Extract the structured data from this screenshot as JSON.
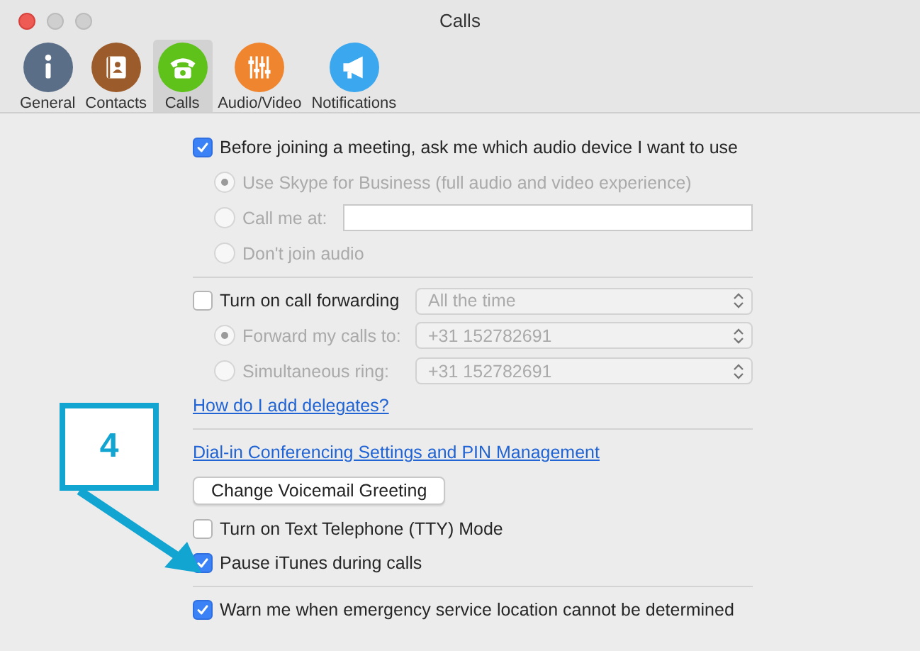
{
  "window": {
    "title": "Calls"
  },
  "toolbar": [
    {
      "label": "General",
      "kind": "info",
      "color": "#5b6e88",
      "selected": false
    },
    {
      "label": "Contacts",
      "kind": "contacts",
      "color": "#9c5b2a",
      "selected": false
    },
    {
      "label": "Calls",
      "kind": "phone",
      "color": "#5fc21a",
      "selected": true
    },
    {
      "label": "Audio/Video",
      "kind": "sliders",
      "color": "#f08530",
      "selected": false
    },
    {
      "label": "Notifications",
      "kind": "megaphone",
      "color": "#3aa7ee",
      "selected": false
    }
  ],
  "audio": {
    "checkbox": {
      "label": "Before joining a meeting, ask me which audio device I want to use",
      "checked": true
    },
    "disabled": true,
    "options": [
      {
        "label": "Use Skype for Business (full audio and video experience)",
        "selected": true
      },
      {
        "label": "Call me at:",
        "selected": false,
        "kind": "field"
      },
      {
        "label": "Don't join audio",
        "selected": false
      }
    ]
  },
  "forwarding": {
    "checkbox": {
      "label": "Turn on call forwarding",
      "checked": false
    },
    "select": "All the time",
    "disabled": true,
    "options": [
      {
        "label": "Forward my calls to:",
        "selected": true,
        "select": "+31 152782691"
      },
      {
        "label": "Simultaneous ring:",
        "selected": false,
        "select": "+31 152782691"
      }
    ]
  },
  "delegates_link": "How do I add delegates?",
  "dialin_link": "Dial-in Conferencing Settings and PIN Management",
  "voicemail_button": "Change Voicemail Greeting",
  "options": [
    {
      "label": "Turn on Text Telephone (TTY) Mode",
      "checked": false
    },
    {
      "label": "Pause iTunes during calls",
      "checked": true
    }
  ],
  "emergency": {
    "label": "Warn me when emergency service location cannot be determined",
    "checked": true
  },
  "callout": {
    "label": "4"
  }
}
